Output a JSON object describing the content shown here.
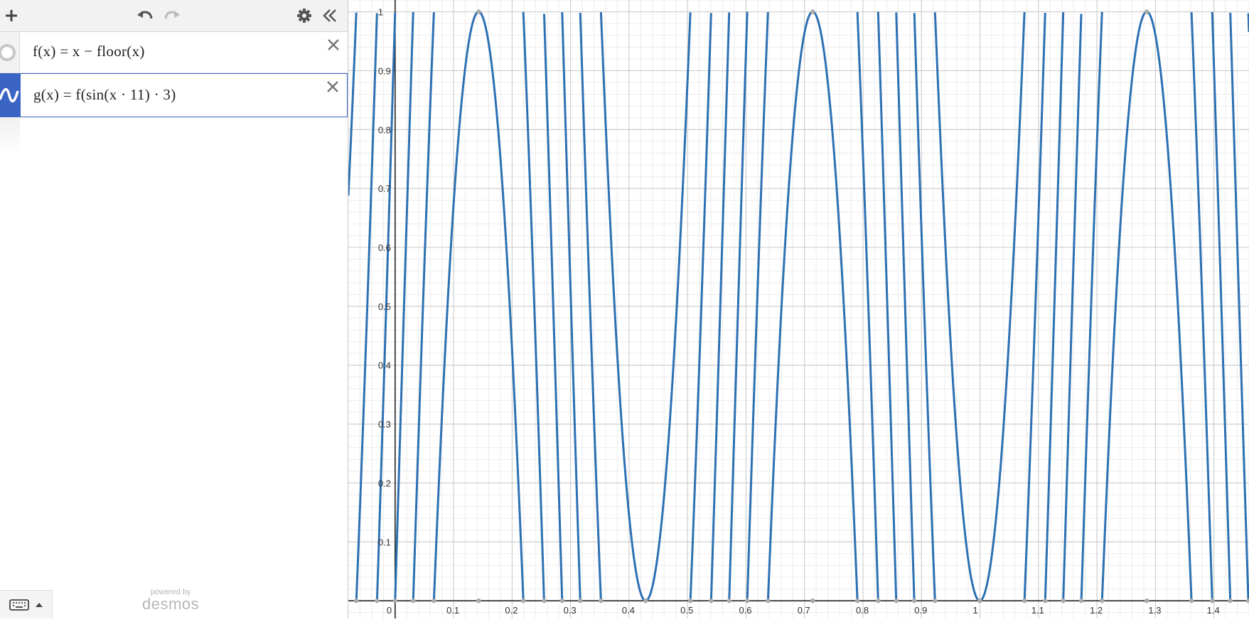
{
  "toolbar": {
    "add_icon": "plus-icon",
    "undo_icon": "undo-icon",
    "redo_icon": "redo-icon",
    "settings_icon": "gear-icon",
    "collapse_icon": "double-chevron-left-icon"
  },
  "expressions": [
    {
      "text": "f(x) = x − floor(x)",
      "color": "#c7c7c7",
      "icon": "hidden-circle-icon"
    },
    {
      "text": "g(x) = f(sin(x · 11) · 3)",
      "color": "#2d70b3",
      "icon": "curve-icon",
      "selected": true
    }
  ],
  "footer": {
    "keypad_icon": "keyboard-icon",
    "branding_small": "powered by",
    "branding_large": "desmos"
  },
  "chart_data": {
    "type": "line",
    "title": "",
    "xlabel": "",
    "ylabel": "",
    "xlim": [
      -0.08,
      1.46
    ],
    "ylim": [
      -0.03,
      1.02
    ],
    "x_tick_labels": [
      "0",
      "0.1",
      "0.2",
      "0.3",
      "0.4",
      "0.5",
      "0.6",
      "0.7",
      "0.8",
      "0.9",
      "1",
      "1.1",
      "1.2",
      "1.3",
      "1.4"
    ],
    "y_tick_labels": [
      "0.1",
      "0.2",
      "0.3",
      "0.4",
      "0.5",
      "0.6",
      "0.7",
      "0.8",
      "0.9",
      "1"
    ],
    "grid": true,
    "series": [
      {
        "function": "g(x) = f(sin(11x) · 3)",
        "color": "#2d70b3"
      }
    ]
  }
}
